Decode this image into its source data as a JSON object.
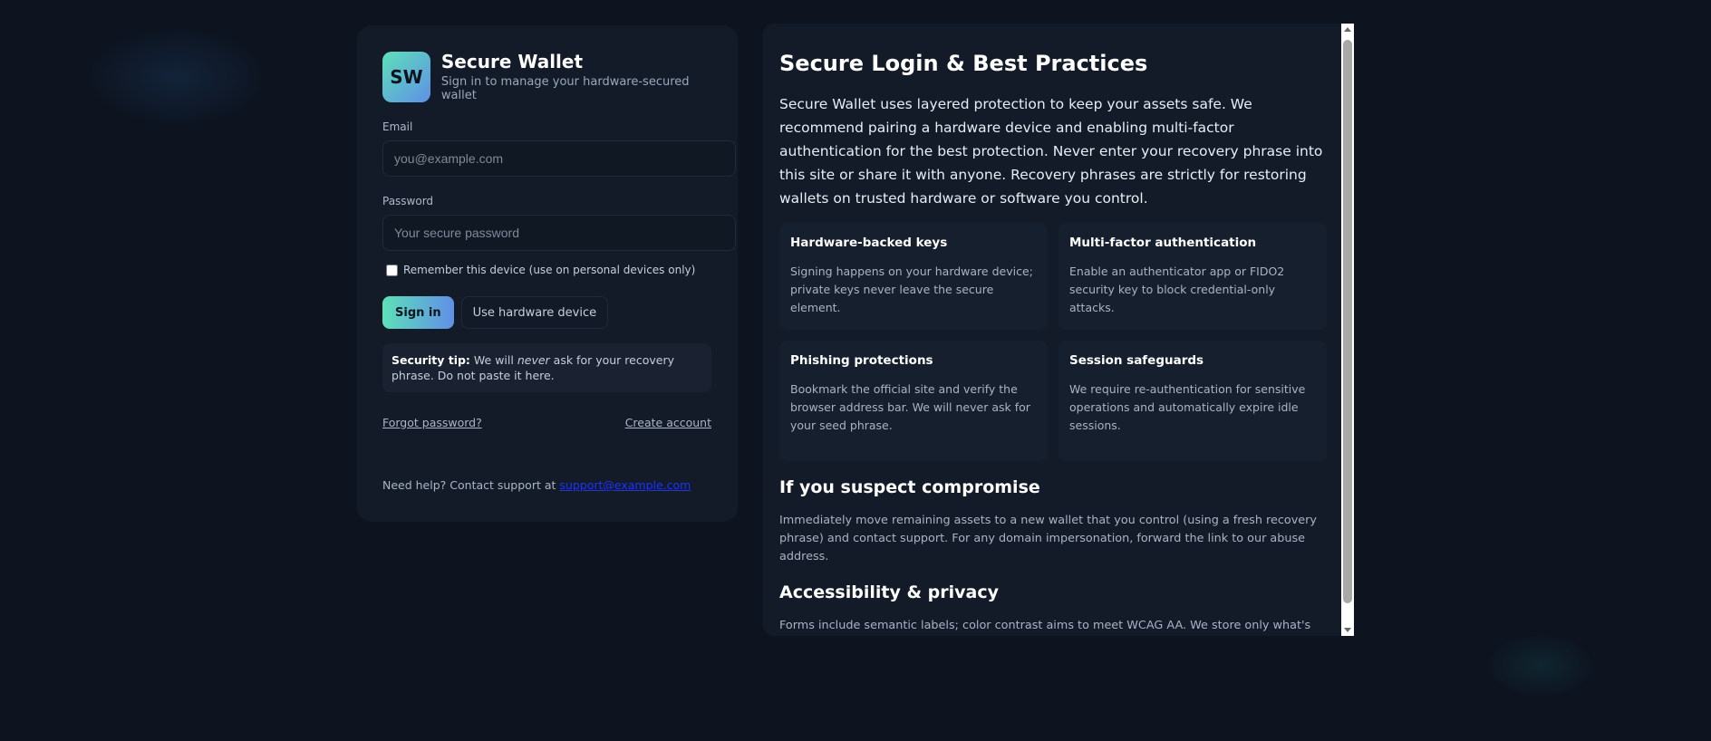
{
  "login": {
    "logo_text": "SW",
    "title": "Secure Wallet",
    "subtitle": "Sign in to manage your hardware-secured wallet",
    "email_label": "Email",
    "email_placeholder": "you@example.com",
    "email_value": "",
    "password_label": "Password",
    "password_placeholder": "Your secure password",
    "password_value": "",
    "remember_label": "Remember this device (use on personal devices only)",
    "remember_checked": false,
    "signin_label": "Sign in",
    "hardware_label": "Use hardware device",
    "tip_label": "Security tip:",
    "tip_text_1": "We will",
    "tip_emphasis": "never",
    "tip_text_2": "ask for your recovery phrase. Do not paste it here.",
    "forgot_label": "Forgot password?",
    "create_label": "Create account",
    "help_text": "Need help? Contact support at",
    "support_email": "support@example.com"
  },
  "panel": {
    "title": "Secure Login & Best Practices",
    "intro": "Secure Wallet uses layered protection to keep your assets safe. We recommend pairing a hardware device and enabling multi-factor authentication for the best protection. Never enter your recovery phrase into this site or share it with anyone. Recovery phrases are strictly for restoring wallets on trusted hardware or software you control.",
    "features": [
      {
        "title": "Hardware-backed keys",
        "body": "Signing happens on your hardware device; private keys never leave the secure element."
      },
      {
        "title": "Multi-factor authentication",
        "body": "Enable an authenticator app or FIDO2 security key to block credential-only attacks."
      },
      {
        "title": "Phishing protections",
        "body": "Bookmark the official site and verify the browser address bar. We will never ask for your seed phrase."
      },
      {
        "title": "Session safeguards",
        "body": "We require re-authentication for sensitive operations and automatically expire idle sessions."
      }
    ],
    "compromise_title": "If you suspect compromise",
    "compromise_text": "Immediately move remaining assets to a new wallet that you control (using a fresh recovery phrase) and contact support. For any domain impersonation, forward the link to our abuse address.",
    "privacy_title": "Accessibility & privacy",
    "privacy_text": "Forms include semantic labels; color contrast aims to meet WCAG AA. We store only what's necessary for"
  },
  "colors": {
    "background": "#0d1420",
    "card": "#131b28",
    "accent_start": "#5ee0b8",
    "accent_end": "#5f8fe6",
    "link": "#1a33ff"
  }
}
